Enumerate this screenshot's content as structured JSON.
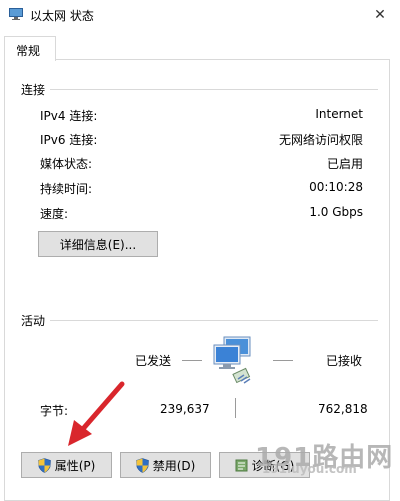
{
  "window": {
    "title": "以太网 状态",
    "close_symbol": "✕"
  },
  "tabs": [
    {
      "label": "常规"
    }
  ],
  "connection": {
    "section_label": "连接",
    "rows": [
      {
        "label": "IPv4 连接:",
        "value": "Internet"
      },
      {
        "label": "IPv6 连接:",
        "value": "无网络访问权限"
      },
      {
        "label": "媒体状态:",
        "value": "已启用"
      },
      {
        "label": "持续时间:",
        "value": "00:10:28"
      },
      {
        "label": "速度:",
        "value": "1.0 Gbps"
      }
    ],
    "details_button": "详细信息(E)..."
  },
  "activity": {
    "section_label": "活动",
    "sent_label": "已发送",
    "received_label": "已接收",
    "bytes_label": "字节:",
    "bytes_sent": "239,637",
    "bytes_received": "762,818"
  },
  "buttons": {
    "properties": "属性(P)",
    "disable": "禁用(D)",
    "diagnose": "诊断(G)"
  },
  "watermark": {
    "main": "191路由网",
    "sub": "191luyou.com"
  },
  "colors": {
    "arrow": "#d9262c",
    "shield_blue": "#2f6fc4",
    "shield_yellow": "#f3c33b"
  }
}
